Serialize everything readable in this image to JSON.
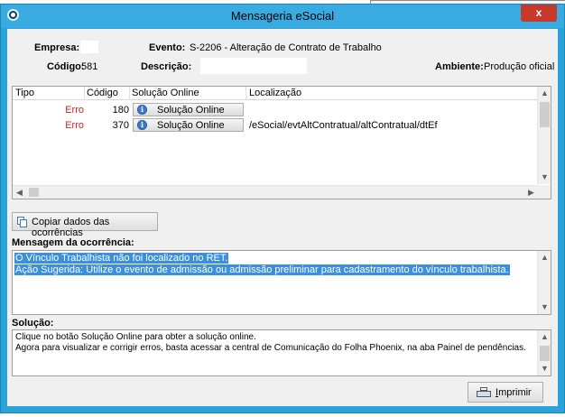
{
  "window": {
    "title": "Mensageria eSocial",
    "close_label": "x"
  },
  "header": {
    "empresa_label": "Empresa:",
    "empresa_value": "",
    "evento_label": "Evento:",
    "evento_value": "S-2206 - Alteração de Contrato de Trabalho",
    "codigo_label": "Código:",
    "codigo_value": "581",
    "descricao_label": "Descrição:",
    "descricao_value": "",
    "ambiente_label": "Ambiente:",
    "ambiente_value": "Produção oficial"
  },
  "grid": {
    "columns": [
      "Tipo",
      "Código",
      "Solução Online",
      "Localização"
    ],
    "rows": [
      {
        "tipo": "Erro",
        "codigo": "180",
        "solucao": "Solução Online",
        "localizacao": ""
      },
      {
        "tipo": "Erro",
        "codigo": "370",
        "solucao": "Solução Online",
        "localizacao": "/eSocial/evtAltContratual/altContratual/dtEf"
      }
    ],
    "info_glyph": "i"
  },
  "copy_button_label": "Copiar dados das ocorrências",
  "mensagem": {
    "title": "Mensagem da ocorrência:",
    "lines": [
      "O Vínculo Trabalhista não foi localizado no RET.",
      "Ação Sugerida: Utilize o evento de admissão ou admissão preliminar para cadastramento do vínculo trabalhista."
    ]
  },
  "solucao": {
    "title": "Solução:",
    "lines": [
      "Clique no botão Solução Online para obter a solução online.",
      "Agora para visualizar e corrigir erros, basta acessar a central de Comunicação do Folha Phoenix, na aba Painel de pendências."
    ]
  },
  "print_button": {
    "prefix": "",
    "underlined": "I",
    "rest": "mprimir"
  },
  "icons": {
    "app": "esocial-app-icon",
    "info": "info-icon",
    "copy": "copy-icon",
    "print": "printer-icon"
  },
  "colors": {
    "titlebar": "#3aabe0",
    "error_text": "#d42020",
    "selection": "#3c8fdc",
    "close_button": "#c7392b"
  }
}
